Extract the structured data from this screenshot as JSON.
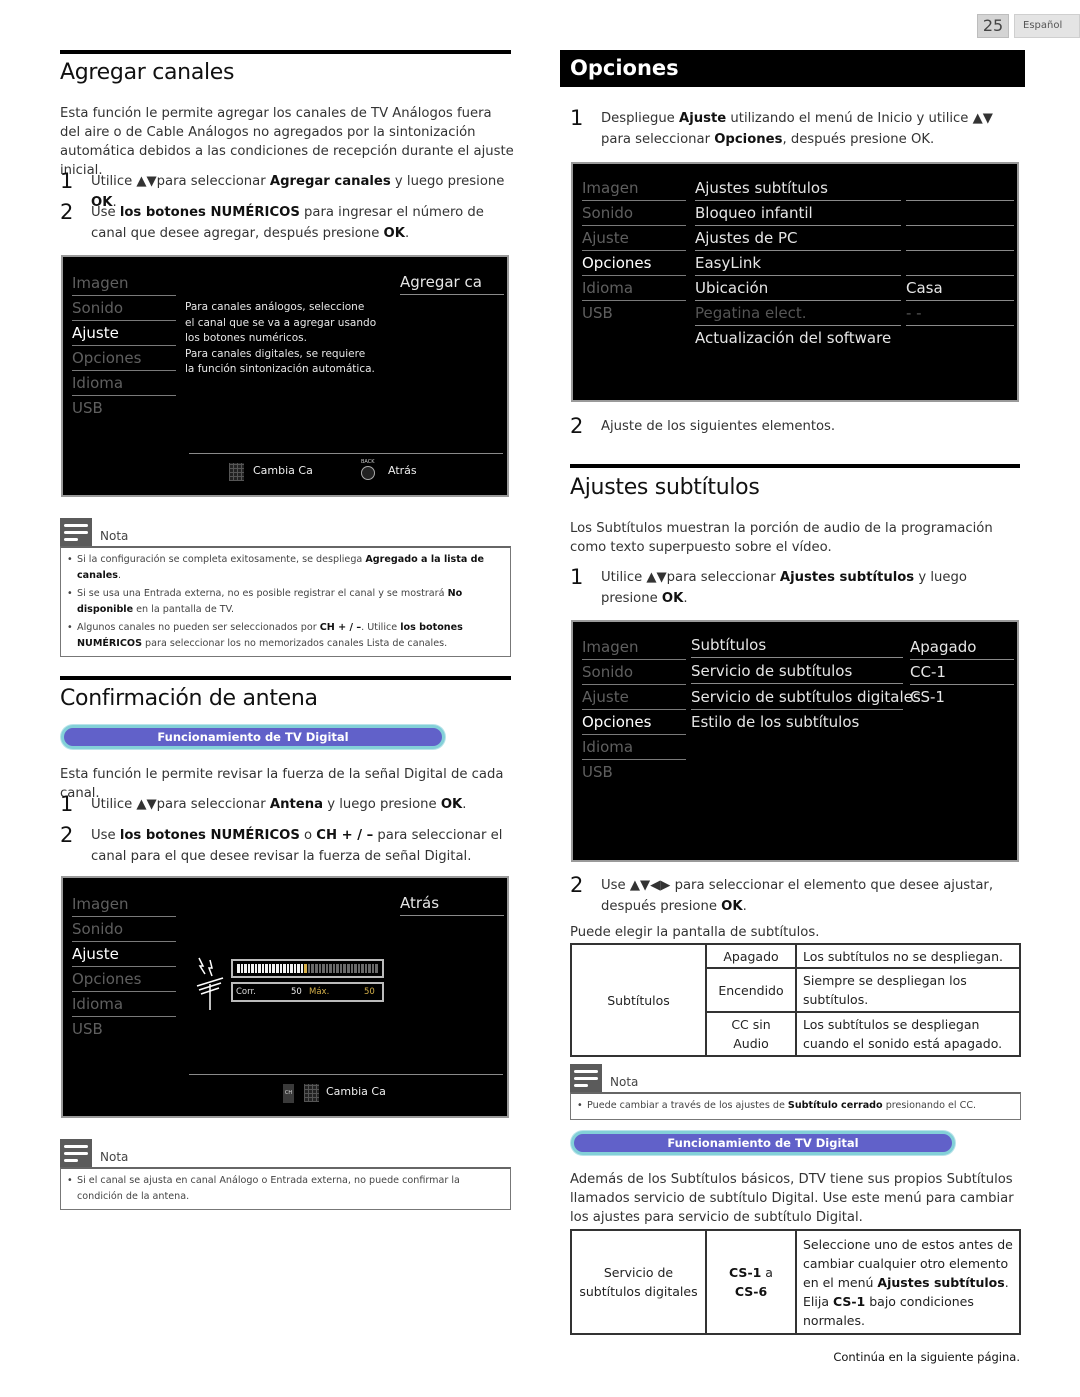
{
  "page": {
    "number": "25",
    "language": "Español"
  },
  "agregar": {
    "title": "Agregar canales",
    "intro": "Esta función le permite agregar los canales de TV Análogos fuera del aire o de Cable Análogos no agregados por la sintonización automática debidos a las condiciones de recepción durante el ajuste inicial.",
    "steps": [
      {
        "n": "1",
        "pre": "Utilice ▲▼para seleccionar ",
        "bold": "Agregar canales",
        "mid": " y luego presione ",
        "bold2": "OK",
        "post": "."
      },
      {
        "n": "2",
        "pre": "Use ",
        "bold": "los botones NUMÉRICOS",
        "mid": " para ingresar el número de canal que desee agregar, después presione ",
        "bold2": "OK",
        "post": "."
      }
    ],
    "screen": {
      "menu": [
        "Imagen",
        "Sonido",
        "Ajuste",
        "Opciones",
        "Idioma",
        "USB"
      ],
      "selected": "Ajuste",
      "header": "Agregar ca",
      "body_lines": [
        "Para canales análogos, seleccione",
        "el canal que se va a agregar usando",
        "los botones numéricos.",
        "Para canales digitales, se requiere",
        "la función sintonización automática."
      ],
      "footer": [
        {
          "icon": "number-pad-icon",
          "label": "Cambia Ca"
        },
        {
          "icon": "back-button-icon",
          "icon_text": "BACK",
          "label": "Atrás"
        }
      ]
    },
    "note": {
      "label": "Nota",
      "items": [
        {
          "pre": "Si la configuración se completa exitosamente, se despliega ",
          "bold": "Agregado a la lista de canales",
          "post": "."
        },
        {
          "pre": "Si se usa una Entrada externa, no es posible registrar el canal y se mostrará ",
          "bold": "No disponible",
          "post": " en la pantalla de TV."
        },
        {
          "pre": "Algunos canales no pueden ser seleccionados por ",
          "bold": "CH + / –",
          "mid": ". Utilice ",
          "bold2": "los botones NUMÉRICOS",
          "post": " para seleccionar los no memorizados canales Lista de canales."
        }
      ]
    }
  },
  "antena": {
    "title": "Confirmación de antena",
    "badge": "Funcionamiento de TV Digital",
    "intro": "Esta función le permite revisar la fuerza de la señal Digital de cada canal.",
    "steps": [
      {
        "n": "1",
        "pre": "Utilice ▲▼para seleccionar ",
        "bold": "Antena",
        "mid": " y luego presione ",
        "bold2": "OK",
        "post": "."
      },
      {
        "n": "2",
        "pre": "Use ",
        "bold": "los botones NUMÉRICOS",
        "mid": " o ",
        "bold2": "CH + / –",
        "post": " para seleccionar el canal para el que desee revisar la fuerza de señal Digital."
      }
    ],
    "screen": {
      "menu": [
        "Imagen",
        "Sonido",
        "Ajuste",
        "Opciones",
        "Idioma",
        "USB"
      ],
      "selected": "Ajuste",
      "header": "Atrás",
      "signal": {
        "current_label": "Corr.",
        "current": "50",
        "max_label": "Máx.",
        "max": "50",
        "level_fraction": 0.5,
        "segments": 40
      },
      "footer": [
        {
          "icon": "channel-up-down-icon",
          "icon_text": "CH"
        },
        {
          "icon": "number-pad-icon",
          "label": "Cambia Ca"
        }
      ]
    },
    "note": {
      "label": "Nota",
      "items": [
        {
          "pre": "Si el canal se ajusta en canal Análogo o Entrada externa, no puede confirmar la condición de la antena."
        }
      ]
    }
  },
  "opciones": {
    "title": "Opciones",
    "steps": [
      {
        "n": "1",
        "pre": "Despliegue ",
        "bold": "Ajuste",
        "mid": " utilizando el menú de Inicio y utilice ▲▼ para seleccionar ",
        "bold2": "Opciones",
        "post": ", después presione OK."
      },
      {
        "n": "2",
        "pre": "Ajuste de los siguientes elementos."
      }
    ],
    "screen": {
      "menu": [
        "Imagen",
        "Sonido",
        "Ajuste",
        "Opciones",
        "Idioma",
        "USB"
      ],
      "selected": "Opciones",
      "items": [
        {
          "label": "Ajustes subtítulos",
          "value": ""
        },
        {
          "label": "Bloqueo infantil",
          "value": ""
        },
        {
          "label": "Ajustes de PC",
          "value": ""
        },
        {
          "label": "EasyLink",
          "value": ""
        },
        {
          "label": "Ubicación",
          "value": "Casa"
        },
        {
          "label": "Pegatina elect.",
          "value": "- -",
          "disabled": true
        },
        {
          "label": "Actualización del software",
          "value": ""
        }
      ]
    }
  },
  "subtitulos": {
    "title": "Ajustes subtítulos",
    "intro": "Los Subtítulos muestran la porción de audio de la programación como texto superpuesto sobre el vídeo.",
    "steps": [
      {
        "n": "1",
        "pre": "Utilice ▲▼para seleccionar ",
        "bold": "Ajustes subtítulos",
        "mid": " y luego presione ",
        "bold2": "OK",
        "post": "."
      },
      {
        "n": "2",
        "pre": "Use ▲▼◀▶ para seleccionar el elemento que desee ajustar, después presione ",
        "bold": "OK",
        "post": "."
      }
    ],
    "screen": {
      "menu": [
        "Imagen",
        "Sonido",
        "Ajuste",
        "Opciones",
        "Idioma",
        "USB"
      ],
      "selected": "Opciones",
      "items": [
        {
          "label": "Subtítulos",
          "value": "Apagado"
        },
        {
          "label": "Servicio de subtítulos",
          "value": "CC-1"
        },
        {
          "label": "Servicio de subtítulos digitales",
          "value": "CS-1"
        },
        {
          "label": "Estilo de los subtítulos",
          "value": ""
        }
      ]
    },
    "table_intro": "Puede elegir la pantalla de subtítulos.",
    "table1": {
      "row_header": "Subtítulos",
      "rows": [
        {
          "option": "Apagado",
          "desc": "Los subtítulos no se despliegan."
        },
        {
          "option": "Encendido",
          "desc": "Siempre se despliegan los subtítulos."
        },
        {
          "option": "CC sin Audio",
          "desc": "Los subtítulos se despliegan cuando el sonido está apagado."
        }
      ]
    },
    "note": {
      "label": "Nota",
      "items": [
        {
          "pre": "Puede cambiar a través de los ajustes de ",
          "bold": "Subtítulo cerrado",
          "post": " presionando el CC."
        }
      ]
    },
    "badge": "Funcionamiento de TV Digital",
    "digital_intro": "Además de los Subtítulos básicos, DTV tiene sus propios Subtítulos llamados servicio de subtítulo Digital. Use este menú para cambiar los ajustes para servicio de subtítulo Digital.",
    "table2": {
      "row_header": "Servicio de subtítulos digitales",
      "option_bold1": "CS-1",
      "option_mid": " a ",
      "option_bold2": "CS-6",
      "desc_pre": "Seleccione uno de estos antes de cambiar cualquier otro elemento en el menú ",
      "desc_bold": "Ajustes subtítulos",
      "desc_mid": ". Elija ",
      "desc_bold2": "CS-1",
      "desc_post": " bajo condiciones normales."
    }
  },
  "footer_text": "Continúa en la siguiente página."
}
